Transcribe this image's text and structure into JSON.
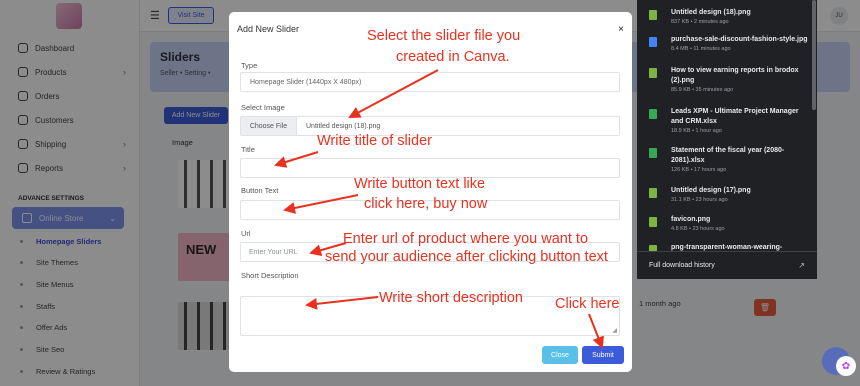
{
  "sidebar": {
    "items": [
      {
        "label": "Dashboard",
        "icon": "dashboard-icon"
      },
      {
        "label": "Products",
        "icon": "products-icon",
        "chevron": "›"
      },
      {
        "label": "Orders",
        "icon": "orders-icon"
      },
      {
        "label": "Customers",
        "icon": "customers-icon"
      },
      {
        "label": "Shipping",
        "icon": "shipping-icon",
        "chevron": "›"
      },
      {
        "label": "Reports",
        "icon": "reports-icon",
        "chevron": "›"
      }
    ],
    "section_label": "ADVANCE SETTINGS",
    "online_store": {
      "label": "Online Store",
      "chevron": "⌄"
    },
    "sub_items": [
      {
        "label": "Homepage Sliders",
        "active": true
      },
      {
        "label": "Site Themes"
      },
      {
        "label": "Site Menus"
      },
      {
        "label": "Staffs"
      },
      {
        "label": "Offer Ads"
      },
      {
        "label": "Site Seo"
      },
      {
        "label": "Review & Ratings"
      }
    ]
  },
  "topbar": {
    "visit_label": "Visit Site",
    "avatar_initials": "JU"
  },
  "page": {
    "title": "Sliders",
    "breadcrumb": "Seller • Setting •",
    "add_button": "Add New Slider",
    "col_image": "Image",
    "thumb2_text": "NEW",
    "row_time": "1 month ago"
  },
  "modal": {
    "title": "Add New Slider",
    "close_icon": "×",
    "type_label": "Type",
    "type_value": "Homepage Slider (1440px X 480px)",
    "select_image_label": "Select Image",
    "choose_file": "Choose File",
    "file_name": "Untitled design (18).png",
    "title_label": "Title",
    "button_text_label": "Button Text",
    "url_label": "Url",
    "url_placeholder": "Enter Your URL",
    "short_desc_label": "Short Description",
    "close_button": "Close",
    "submit_button": "Submit"
  },
  "annotations": {
    "select_file_1": "Select the slider file you",
    "select_file_2": "created in Canva.",
    "write_title": "Write title of slider",
    "button_text_1": "Write button text like",
    "button_text_2": "click here, buy now",
    "url_1": "Enter url of product where you want to",
    "url_2": "send your audience after clicking button text",
    "short_desc": "Write short description",
    "click_here": "Click here",
    "color": "#e8321f"
  },
  "downloads": {
    "items": [
      {
        "name": "Untitled design (18).png",
        "meta": "837 KB • 2 minutes ago",
        "icon": "image-file-icon",
        "color": "#7cb342"
      },
      {
        "name": "purchase-sale-discount-fashion-style.jpg",
        "meta": "8.4 MB • 11 minutes ago",
        "icon": "image-file-icon",
        "color": "#4285f4"
      },
      {
        "name": "How to view earning reports in brodox (2).png",
        "meta": "85.9 KB • 35 minutes ago",
        "icon": "image-file-icon",
        "color": "#7cb342"
      },
      {
        "name": "Leads  XPM - Ultimate Project Manager and CRM.xlsx",
        "meta": "18.9 KB • 1 hour ago",
        "icon": "spreadsheet-file-icon",
        "color": "#34a853"
      },
      {
        "name": "Statement of the fiscal year (2080-2081).xlsx",
        "meta": "126 KB • 17 hours ago",
        "icon": "spreadsheet-file-icon",
        "color": "#34a853"
      },
      {
        "name": "Untitled design (17).png",
        "meta": "31.1 KB • 23 hours ago",
        "icon": "image-file-icon",
        "color": "#7cb342"
      },
      {
        "name": "favicon.png",
        "meta": "4.8 KB • 23 hours ago",
        "icon": "image-file-icon",
        "color": "#7cb342"
      },
      {
        "name": "png-transparent-woman-wearing-",
        "meta": "",
        "icon": "image-file-icon",
        "color": "#7cb342"
      }
    ],
    "footer": "Full download history",
    "footer_icon": "↗"
  }
}
